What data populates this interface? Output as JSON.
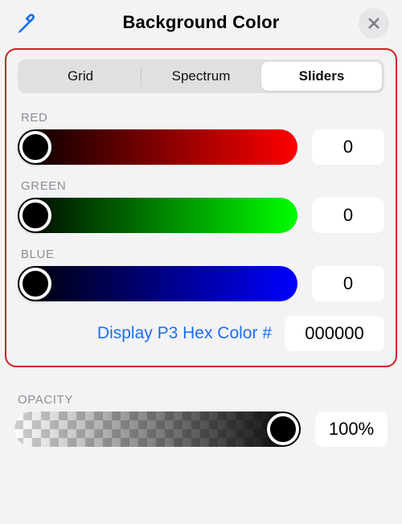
{
  "header": {
    "title": "Background Color"
  },
  "tabs": {
    "grid_label": "Grid",
    "spectrum_label": "Spectrum",
    "sliders_label": "Sliders",
    "selected": "sliders"
  },
  "channels": {
    "red": {
      "label": "RED",
      "value": "0"
    },
    "green": {
      "label": "GREEN",
      "value": "0"
    },
    "blue": {
      "label": "BLUE",
      "value": "0"
    }
  },
  "hex": {
    "link_label": "Display P3 Hex Color #",
    "value": "000000"
  },
  "opacity": {
    "label": "OPACITY",
    "value": "100%"
  }
}
